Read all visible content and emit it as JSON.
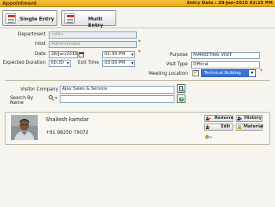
{
  "window": {
    "title": "Appointment",
    "entry_date_label": "Entry Date : 28-Jan-2015 02:25 PM"
  },
  "tabs": [
    {
      "label": "Single Entry"
    },
    {
      "label": "Multi Entry"
    }
  ],
  "form": {
    "department": {
      "label": "Department",
      "value": "<All>"
    },
    "host": {
      "label": "Host",
      "value": "Administrator"
    },
    "date": {
      "label": "Date",
      "value": "28/Jan/2015",
      "time": "02:30 PM"
    },
    "expected_duration": {
      "label": "Expected Duration",
      "value": "00:30"
    },
    "exit_time": {
      "label": "Exit Time",
      "value": "03:00 PM"
    },
    "purpose": {
      "label": "Purpose",
      "value": "MARKETING VISIT"
    },
    "visit_type": {
      "label": "Visit Type",
      "value": "Official"
    },
    "meeting_location": {
      "label": "Meeting Location",
      "checkbox": "✓",
      "value": "Technical Building"
    },
    "required_mark": "*"
  },
  "visitor": {
    "company_label": "Visitor Company",
    "company_value": "Ajay Sales & Service",
    "search_label": "Search By Name",
    "search_value": ""
  },
  "card": {
    "name": "Shailesh kamdar",
    "phone": "+91 98250 79072",
    "buttons": {
      "remove": "Remove",
      "history": "History",
      "edit": "Edit",
      "material": "Material"
    }
  },
  "colors": {
    "titlebar": "#e8a811",
    "location_highlight": "#3b74d8",
    "input_border": "#7f9db9",
    "add_button": "#3a9a3a"
  }
}
